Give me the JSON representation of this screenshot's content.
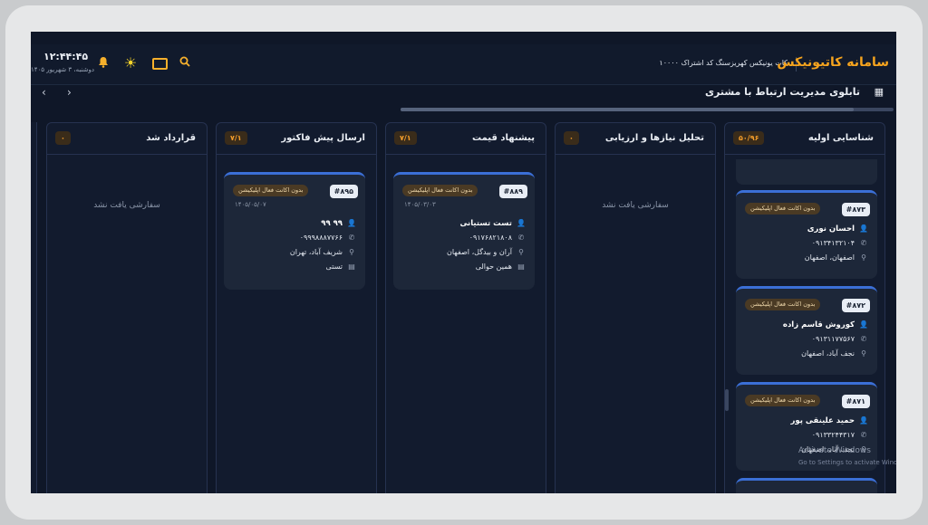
{
  "header": {
    "time": "۱۲:۴۴:۴۵",
    "date": "دوشنبه، ۳ شهریور ۱۴۰۵",
    "brand": "سامانه کاتیونیکس",
    "subtitle": "کات یونیکس کهریزسنگ کد اشتراک ۱۰۰۰۰",
    "icons": [
      "bell-icon",
      "sun-icon",
      "keyboard-icon",
      "search-icon"
    ]
  },
  "page": {
    "title": "تابلوی مدیریت ارتباط با مشتری"
  },
  "columns": [
    {
      "title": "شناسایی اولیه",
      "count": "۵۰/۹۶",
      "cards": [
        {
          "id": "#۸۷۳",
          "badge": "بدون اکانت فعال اپلیکیشن",
          "name": "احسان نوری",
          "phone": "۰۹۱۳۴۱۳۲۱۰۴",
          "address": "اصفهان، اصفهان"
        },
        {
          "id": "#۸۷۲",
          "badge": "بدون اکانت فعال اپلیکیشن",
          "name": "کوروش قاسم زاده",
          "phone": "۰۹۱۳۱۱۷۷۵۶۷",
          "address": "نجف آباد، اصفهان"
        },
        {
          "id": "#۸۷۱",
          "badge": "بدون اکانت فعال اپلیکیشن",
          "name": "حمید علینقی پور",
          "phone": "۰۹۱۳۳۲۴۴۳۱۷",
          "address": "نجف آباد، اصفهان"
        }
      ]
    },
    {
      "title": "تحلیل نیازها و ارزیابی",
      "count": "۰",
      "empty_text": "سفارشی یافت نشد"
    },
    {
      "title": "پیشنهاد قیمت",
      "count": "۷/۱",
      "cards": [
        {
          "id": "#۸۸۹",
          "badge": "بدون اکانت فعال اپلیکیشن",
          "date": "۱۴۰۵/۰۳/۰۳",
          "name": "تست تستیانی",
          "phone": "۰۹۱۷۶۸۲۱۸۰۸",
          "address": "آران و بیدگل، اصفهان",
          "note": "همین حوالی"
        }
      ]
    },
    {
      "title": "ارسال پیش فاکتور",
      "count": "۷/۱",
      "cards": [
        {
          "id": "#۸۹۵",
          "badge": "بدون اکانت فعال اپلیکیشن",
          "date": "۱۴۰۵/۰۵/۰۷",
          "name": "۹۹ ۹۹",
          "phone": "۰۹۹۹۸۸۸۷۷۶۶",
          "address": "شریف آباد، تهران",
          "note": "تستی"
        }
      ]
    },
    {
      "title": "قرارداد شد",
      "count": "۰",
      "empty_text": "سفارشی یافت نشد"
    }
  ],
  "watermark": {
    "title": "Activate Windows",
    "subtitle": "Go to Settings to activate Windows."
  }
}
